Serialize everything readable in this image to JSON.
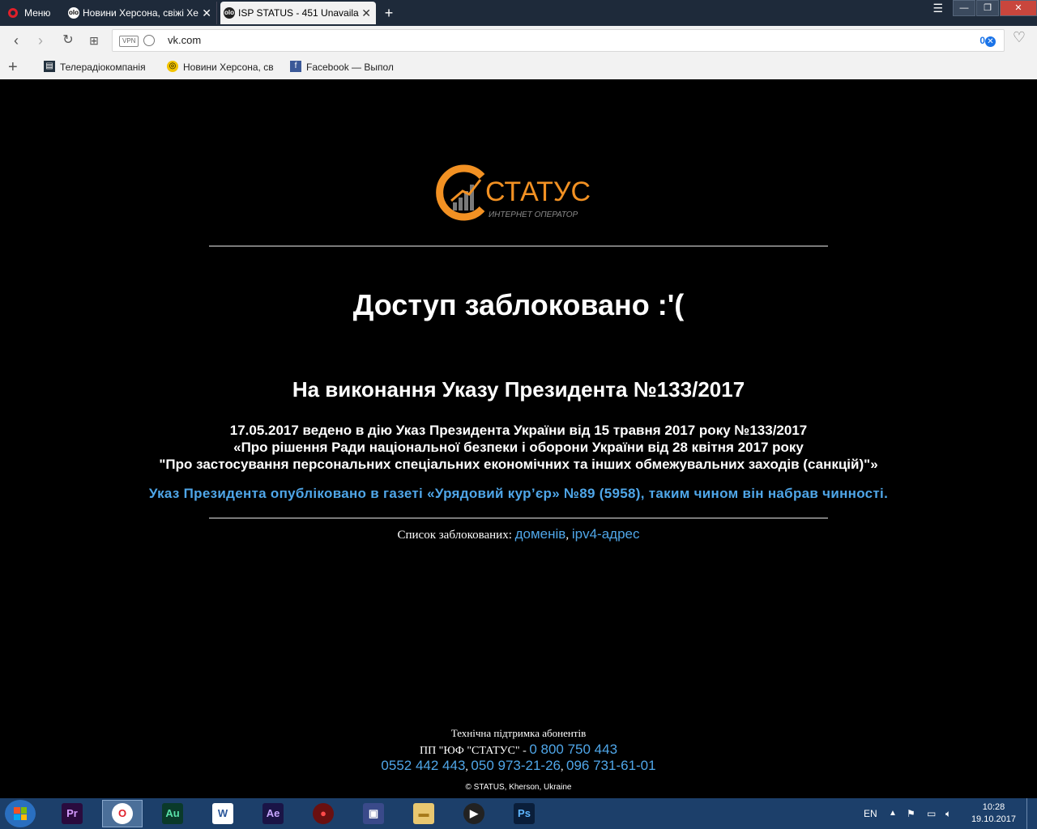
{
  "browser": {
    "menu_label": "Меню",
    "tabs": [
      {
        "title": "Новини Херсона, свіжі Хе",
        "icon": "olo-site-icon"
      },
      {
        "title": "ISP STATUS - 451 Unavaila",
        "icon": "olo-site-icon"
      }
    ],
    "new_tab": "+",
    "url": "vk.com",
    "vpn_label": "VPN",
    "adblock_count": "0",
    "bookmarks": [
      {
        "title": "Телерадіокомпанія",
        "icon": "tv-channel-icon"
      },
      {
        "title": "Новини Херсона, св",
        "icon": "news-site-icon"
      },
      {
        "title": "Facebook — Выпол",
        "icon": "facebook-icon"
      }
    ]
  },
  "page": {
    "logo": {
      "word": "СТАТУС",
      "subtitle": "ИНТЕРНЕТ ОПЕРАТОР",
      "accent_color": "#f29123"
    },
    "title": "Доступ заблоковано :'(",
    "decree_heading": "На виконання Указу Президента №133/2017",
    "decree_lines": [
      "17.05.2017 ведено в дію Указ Президента України від 15 травня 2017 року №133/2017",
      "«Про рішення Ради національної безпеки і оборони України від 28 квітня 2017 року",
      "\"Про застосування персональних спеціальних економічних та інших обмежувальних заходів (санкцій)\"»"
    ],
    "publication_link": "Указ Президента опубліковано в газеті «Урядовий кур’єр» №89 (5958), таким чином він набрав чинності.",
    "blocked_list_label": "Список заблокованих:",
    "blocked_list_domains": "доменів",
    "blocked_list_separator": ",",
    "blocked_list_ipv4": "ipv4-адрес",
    "footer": {
      "support_title": "Технічна підтримка абонентів",
      "company": "ПП \"ЮФ \"СТАТУС\" -",
      "phone_main": "0 800 750 443",
      "phone_1": "0552 442 443",
      "phone_2": "050 973-21-26",
      "phone_3": "096 731-61-01",
      "copyright": "© STATUS, Kherson, Ukraine"
    },
    "link_color": "#4fa6e8"
  },
  "taskbar": {
    "apps": [
      {
        "name": "premiere-icon",
        "label": "Pr",
        "bg": "#2a0b3e",
        "fg": "#d59bff"
      },
      {
        "name": "opera-icon",
        "label": "O",
        "bg": "#ffffff",
        "fg": "#e0202a"
      },
      {
        "name": "audition-icon",
        "label": "Au",
        "bg": "#0a3a2a",
        "fg": "#59e0a8"
      },
      {
        "name": "word-icon",
        "label": "W",
        "bg": "#ffffff",
        "fg": "#2b579a"
      },
      {
        "name": "after-effects-icon",
        "label": "Ae",
        "bg": "#1a1446",
        "fg": "#c7a6ff"
      },
      {
        "name": "joystick-icon",
        "label": "●",
        "bg": "#6a1010",
        "fg": "#ff4a4a"
      },
      {
        "name": "floppy-icon",
        "label": "▣",
        "bg": "#3a4a8a",
        "fg": "#ffffff"
      },
      {
        "name": "folder-icon",
        "label": "▬",
        "bg": "#e8c770",
        "fg": "#a67a1a"
      },
      {
        "name": "media-player-icon",
        "label": "▶",
        "bg": "#222222",
        "fg": "#ffffff"
      },
      {
        "name": "photoshop-icon",
        "label": "Ps",
        "bg": "#0a1e3a",
        "fg": "#5fb6ff"
      }
    ],
    "language": "EN",
    "time": "10:28",
    "date": "19.10.2017"
  }
}
